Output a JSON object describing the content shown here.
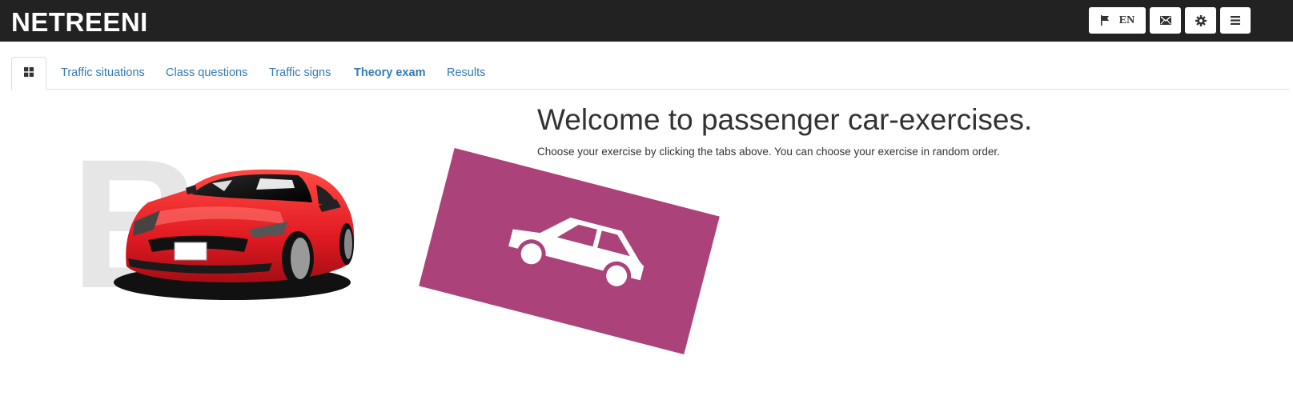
{
  "header": {
    "logo": "NETREENI",
    "language_code": "EN",
    "buttons": {
      "language": "flag-icon",
      "mail": "envelope-icon",
      "settings": "gear-icon",
      "menu": "hamburger-menu-icon"
    }
  },
  "tabs": {
    "home_icon": "grid-icon",
    "items": [
      {
        "label": "Traffic situations"
      },
      {
        "label": "Class questions"
      },
      {
        "label": "Traffic signs"
      },
      {
        "label": "Theory exam"
      },
      {
        "label": "Results"
      }
    ]
  },
  "main": {
    "title": "Welcome to passenger car-exercises.",
    "subtitle": "Choose your exercise by clicking the tabs above. You can choose your exercise in random order.",
    "class_letter": "B",
    "colors": {
      "header_bg": "#222222",
      "link": "#337ab7",
      "card": "#ab437a",
      "car_red": "#e8202a"
    }
  }
}
